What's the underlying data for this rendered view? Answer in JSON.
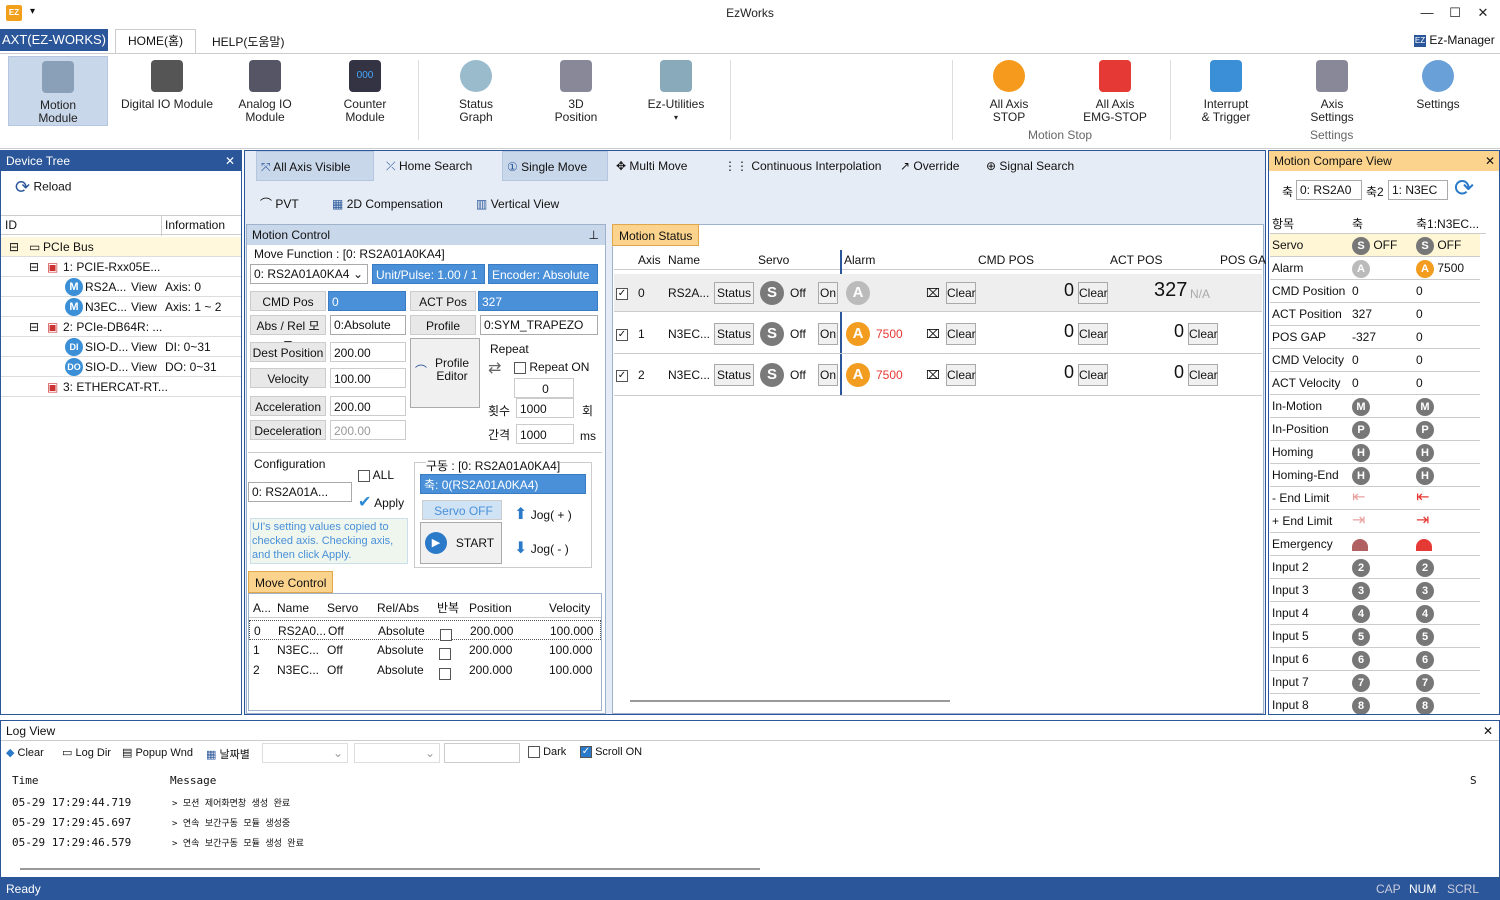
{
  "window": {
    "title": "EzWorks",
    "minimize": "—",
    "maximize": "☐",
    "close": "✕",
    "app_icon": "EZ",
    "quick_access": "▾"
  },
  "ribbon_tabs": {
    "app": "AXT(EZ-WORKS)",
    "home": "HOME(홈)",
    "help": "HELP(도움말)",
    "ez_manager": "Ez-Manager"
  },
  "ribbon": {
    "motion": "Motion\nModule",
    "digital_io": "Digital IO Module",
    "analog_io": "Analog IO\nModule",
    "counter": "Counter\nModule",
    "status_graph": "Status\nGraph",
    "pos_3d": "3D\nPosition",
    "ez_utilities": "Ez-Utilities",
    "all_axis_stop": "All Axis\nSTOP",
    "all_axis_emg": "All Axis\nEMG-STOP",
    "motion_stop_group": "Motion Stop",
    "interrupt": "Interrupt\n& Trigger",
    "axis_settings": "Axis\nSettings",
    "settings_group": "Settings",
    "settings": "Settings"
  },
  "device_tree": {
    "title": "Device Tree",
    "reload": "Reload",
    "col_id": "ID",
    "col_info": "Information",
    "rows": [
      {
        "id": "PCIe Bus",
        "info": ""
      },
      {
        "id": "1: PCIE-Rxx05E...",
        "info": ""
      },
      {
        "id": "RS2A...",
        "view": "View",
        "info": "Axis: 0"
      },
      {
        "id": "N3EC...",
        "view": "View",
        "info": "Axis: 1 ~ 2"
      },
      {
        "id": "2: PCIe-DB64R: ...",
        "info": ""
      },
      {
        "id": "SIO-D...",
        "view": "View",
        "info": "DI: 0~31"
      },
      {
        "id": "SIO-D...",
        "view": "View",
        "info": "DO: 0~31"
      },
      {
        "id": "3: ETHERCAT-RT...",
        "info": ""
      }
    ]
  },
  "toolbar": {
    "all_axis_visible": "All Axis Visible",
    "home_search": "Home Search",
    "single_move": "Single Move",
    "multi_move": "Multi Move",
    "continuous_interp": "Continuous Interpolation",
    "override": "Override",
    "signal_search": "Signal Search",
    "pvt": "PVT",
    "comp_2d": "2D Compensation",
    "vertical_view": "Vertical View"
  },
  "motion_control": {
    "title": "Motion Control",
    "move_function": "Move Function : [0: RS2A01A0KA4]",
    "axis_select": "0: RS2A01A0KA4",
    "unit_pulse": "Unit/Pulse: 1.00 / 1",
    "encoder": "Encoder: Absolute",
    "cmd_pos_label": "CMD Pos",
    "cmd_pos": "0",
    "act_pos_label": "ACT Pos",
    "act_pos": "327",
    "abs_rel_label": "Abs / Rel 모드",
    "abs_rel": "0:Absolute",
    "profile_label": "Profile",
    "profile": "0:SYM_TRAPEZO",
    "dest_label": "Dest Position",
    "dest": "200.00",
    "velocity_label": "Velocity",
    "velocity": "100.00",
    "accel_label": "Acceleration",
    "accel": "200.00",
    "decel_label": "Deceleration",
    "decel": "200.00",
    "profile_editor": "Profile\nEditor",
    "repeat_label": "Repeat",
    "repeat_on": "Repeat ON",
    "repeat_count": "0",
    "count_label": "횟수",
    "count": "1000",
    "count_unit": "회",
    "interval_label": "간격",
    "interval": "1000",
    "interval_unit": "ms",
    "config_label": "Configuration",
    "config_axis": "0: RS2A01A...",
    "all": "ALL",
    "apply": "Apply",
    "note": "UI's setting values copied to checked axis. Checking axis, and then click Apply.",
    "drive_label": "구동 : [0: RS2A01A0KA4]",
    "drive_axis": "축: 0(RS2A01A0KA4)",
    "servo_off": "Servo OFF",
    "start": "START",
    "jog_plus": "Jog( + )",
    "jog_minus": "Jog( - )"
  },
  "move_control": {
    "title": "Move Control",
    "headers": [
      "A...",
      "Name",
      "Servo",
      "Rel/Abs",
      "반복",
      "Position",
      "Velocity"
    ],
    "rows": [
      [
        "0",
        "RS2A0...",
        "Off",
        "Absolute",
        "",
        "200.000",
        "100.000"
      ],
      [
        "1",
        "N3EC...",
        "Off",
        "Absolute",
        "",
        "200.000",
        "100.000"
      ],
      [
        "2",
        "N3EC...",
        "Off",
        "Absolute",
        "",
        "200.000",
        "100.000"
      ]
    ]
  },
  "motion_status": {
    "title": "Motion Status",
    "headers": [
      "Axis",
      "Name",
      "Servo",
      "Alarm",
      "CMD POS",
      "ACT POS",
      "POS GA"
    ],
    "status_btn": "Status",
    "servo_text": "Off",
    "on_btn": "On",
    "clear_btn": "Clear",
    "rows": [
      {
        "axis": "0",
        "name": "RS2A...",
        "alarm": "",
        "cmd": "0",
        "act": "327",
        "act_na": "N/A"
      },
      {
        "axis": "1",
        "name": "N3EC...",
        "alarm": "7500",
        "cmd": "0",
        "act": "0"
      },
      {
        "axis": "2",
        "name": "N3EC...",
        "alarm": "7500",
        "cmd": "0",
        "act": "0"
      }
    ]
  },
  "compare": {
    "title": "Motion Compare View",
    "axis1_label": "축",
    "axis1": "0: RS2A0",
    "axis2_label": "축2",
    "axis2": "1: N3EC",
    "col_item": "항목",
    "col_a": "축",
    "col_b": "축1:N3EC...",
    "rows": [
      {
        "item": "Servo",
        "a": "OFF",
        "b": "OFF"
      },
      {
        "item": "Alarm",
        "a": "",
        "b": "7500"
      },
      {
        "item": "CMD Position",
        "a": "0",
        "b": "0"
      },
      {
        "item": "ACT Position",
        "a": "327",
        "b": "0"
      },
      {
        "item": "POS GAP",
        "a": "-327",
        "b": "0"
      },
      {
        "item": "CMD Velocity",
        "a": "0",
        "b": "0"
      },
      {
        "item": "ACT Velocity",
        "a": "0",
        "b": "0"
      },
      {
        "item": "In-Motion",
        "a": "M",
        "b": "M"
      },
      {
        "item": "In-Position",
        "a": "P",
        "b": "P"
      },
      {
        "item": "Homing",
        "a": "H",
        "b": "H"
      },
      {
        "item": "Homing-End",
        "a": "H",
        "b": "H"
      },
      {
        "item": "- End Limit",
        "a": "",
        "b": ""
      },
      {
        "item": "+ End Limit",
        "a": "",
        "b": ""
      },
      {
        "item": "Emergency",
        "a": "",
        "b": ""
      },
      {
        "item": "Input 2",
        "a": "2",
        "b": "2"
      },
      {
        "item": "Input 3",
        "a": "3",
        "b": "3"
      },
      {
        "item": "Input 4",
        "a": "4",
        "b": "4"
      },
      {
        "item": "Input 5",
        "a": "5",
        "b": "5"
      },
      {
        "item": "Input 6",
        "a": "6",
        "b": "6"
      },
      {
        "item": "Input 7",
        "a": "7",
        "b": "7"
      },
      {
        "item": "Input 8",
        "a": "8",
        "b": "8"
      }
    ]
  },
  "log": {
    "title": "Log View",
    "clear": "Clear",
    "log_dir": "Log Dir",
    "popup": "Popup Wnd",
    "by_date": "날짜별",
    "dark": "Dark",
    "scroll_on": "Scroll ON",
    "col_time": "Time",
    "col_msg": "Message",
    "col_s": "S",
    "entries": [
      {
        "time": "05-29 17:29:44.719",
        "msg": "> 모션 제어화면창 생성 완료"
      },
      {
        "time": "05-29 17:29:45.697",
        "msg": "> 연속 보간구동 모듈 생성중"
      },
      {
        "time": "05-29 17:29:46.579",
        "msg": "> 연속 보간구동 모듈 생성 완료"
      }
    ]
  },
  "statusbar": {
    "ready": "Ready",
    "cap": "CAP",
    "num": "NUM",
    "scrl": "SCRL"
  },
  "colors": {
    "accent": "#2b579a",
    "tab_active": "#fbd38d",
    "alarm_orange": "#f29d20",
    "alarm_red": "#e53935"
  }
}
